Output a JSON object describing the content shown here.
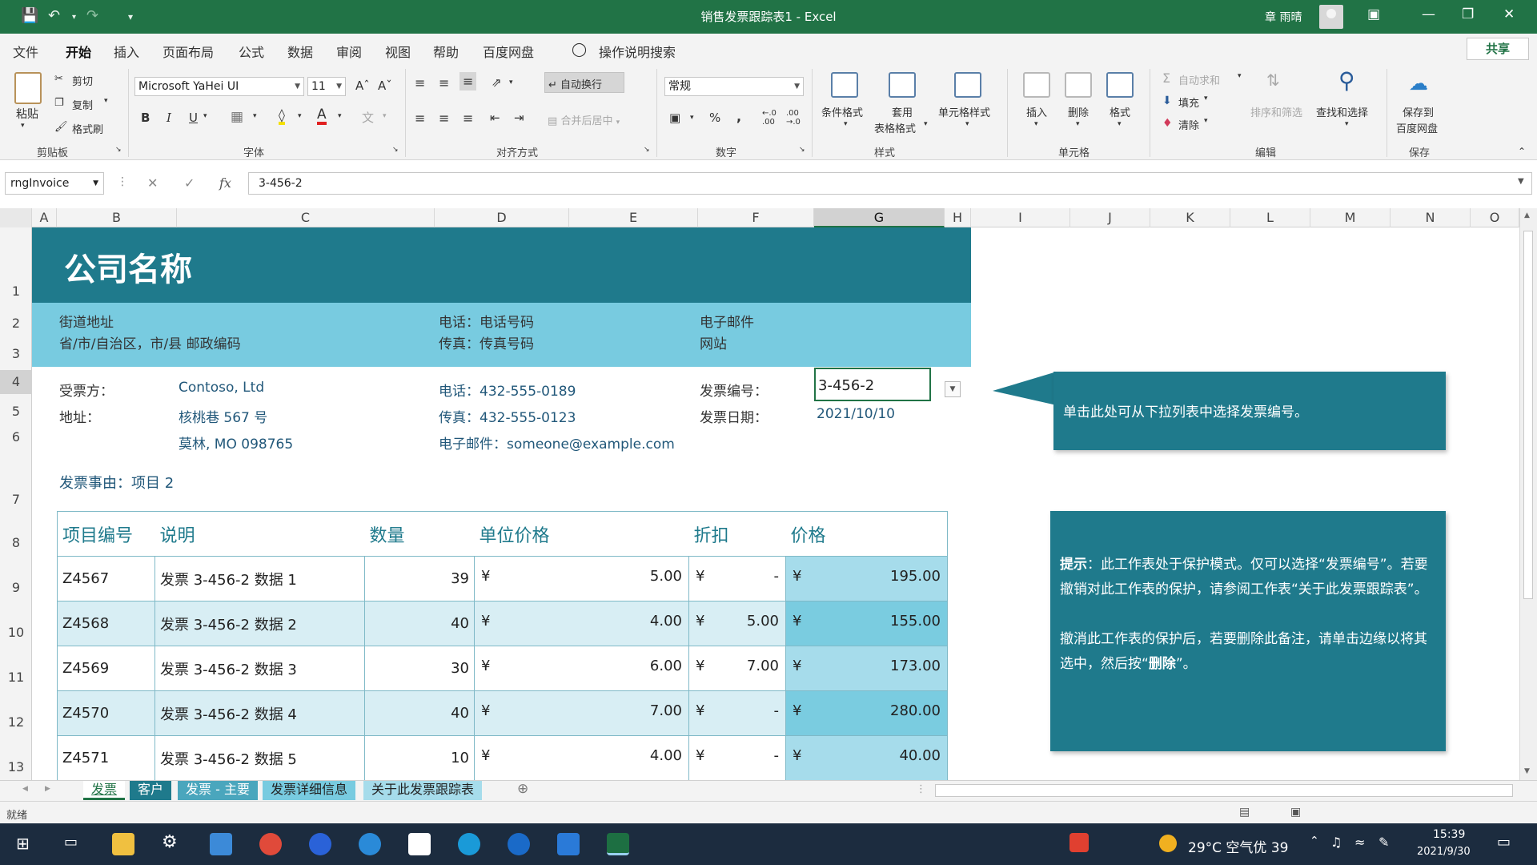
{
  "window": {
    "title": "销售发票跟踪表1  -  Excel",
    "user": "章 雨晴"
  },
  "tabs": [
    "文件",
    "开始",
    "插入",
    "页面布局",
    "公式",
    "数据",
    "审阅",
    "视图",
    "帮助",
    "百度网盘"
  ],
  "tell_me": "操作说明搜索",
  "share": "共享",
  "ribbon": {
    "clipboard": {
      "paste": "粘贴",
      "cut": "剪切",
      "copy": "复制",
      "painter": "格式刷",
      "group": "剪贴板"
    },
    "font": {
      "name": "Microsoft YaHei UI",
      "size": "11",
      "group": "字体"
    },
    "align": {
      "wrap": "自动换行",
      "merge": "合并后居中",
      "group": "对齐方式"
    },
    "number": {
      "format": "常规",
      "group": "数字"
    },
    "styles": {
      "cond": "条件格式",
      "table_1": "套用",
      "table_2": "表格格式",
      "cell": "单元格样式",
      "group": "样式"
    },
    "cells": {
      "insert": "插入",
      "delete": "删除",
      "format": "格式",
      "group": "单元格"
    },
    "editing": {
      "autosum": "自动求和",
      "fill": "填充",
      "clear": "清除",
      "sort": "排序和筛选",
      "find": "查找和选择",
      "group": "编辑"
    },
    "save": {
      "label_1": "保存到",
      "label_2": "百度网盘",
      "group": "保存"
    }
  },
  "formula_bar": {
    "name_box": "rngInvoice",
    "fx": "fx",
    "formula": "3-456-2"
  },
  "columns": [
    "A",
    "B",
    "C",
    "D",
    "E",
    "F",
    "G",
    "H",
    "I",
    "J",
    "K",
    "L",
    "M",
    "N",
    "O"
  ],
  "rows": [
    "1",
    "2",
    "3",
    "4",
    "5",
    "6",
    "7",
    "8",
    "9",
    "10",
    "11",
    "12",
    "13"
  ],
  "selected_column": "G",
  "selected_row": "4",
  "invoice": {
    "company": "公司名称",
    "street": "街道地址",
    "city": "省/市/自治区，市/县  邮政编码",
    "phone": "电话：电话号码",
    "fax": "传真：传真号码",
    "email": "电子邮件",
    "website": "网站",
    "bill_to_label": "受票方：",
    "bill_to": "Contoso, Ltd",
    "address_label": "地址：",
    "address_1": "核桃巷 567 号",
    "address_2": "莫林, MO 098765",
    "client_phone": "电话：432-555-0189",
    "client_fax": "传真：432-555-0123",
    "client_email": "电子邮件：someone@example.com",
    "invoice_no_label": "发票编号：",
    "invoice_no": "3-456-2",
    "invoice_date_label": "发票日期：",
    "invoice_date": "2021/10/10",
    "for_line": "发票事由：项目 2",
    "headers": [
      "项目编号",
      "说明",
      "数量",
      "单位价格",
      "折扣",
      "价格"
    ],
    "currency": "¥",
    "items": [
      {
        "id": "Z4567",
        "desc": "发票 3-456-2 数据 1",
        "qty": "39",
        "unit": "5.00",
        "discount": "-",
        "price": "195.00"
      },
      {
        "id": "Z4568",
        "desc": "发票 3-456-2 数据 2",
        "qty": "40",
        "unit": "4.00",
        "discount": "5.00",
        "price": "155.00"
      },
      {
        "id": "Z4569",
        "desc": "发票 3-456-2 数据 3",
        "qty": "30",
        "unit": "6.00",
        "discount": "7.00",
        "price": "173.00"
      },
      {
        "id": "Z4570",
        "desc": "发票 3-456-2 数据 4",
        "qty": "40",
        "unit": "7.00",
        "discount": "-",
        "price": "280.00"
      },
      {
        "id": "Z4571",
        "desc": "发票 3-456-2 数据 5",
        "qty": "10",
        "unit": "4.00",
        "discount": "-",
        "price": "40.00"
      }
    ]
  },
  "callout": "单击此处可从下拉列表中选择发票编号。",
  "note": {
    "tip_label": "提示",
    "line_1": "：此工作表处于保护模式。仅可以选择“发票编号”。若要撤销对此工作表的保护，请参阅工作表“关于此发票跟踪表”。",
    "line_2a": "撤消此工作表的保护后，若要删除此备注，请单击边缘以将其选中，然后按“",
    "line_2b": "删除",
    "line_2c": "”。"
  },
  "sheet_tabs": [
    "发票",
    "客户",
    "发票 - 主要",
    "发票详细信息",
    "关于此发票跟踪表"
  ],
  "status": "就绪",
  "taskbar": {
    "weather": "29°C  空气优 39",
    "time": "15:39",
    "date": "2021/9/30"
  },
  "colors": {
    "excel_green": "#217346",
    "teal_dark": "#1f7a8c",
    "teal_light": "#78cbe0",
    "row_alt": "#d8eef4"
  }
}
